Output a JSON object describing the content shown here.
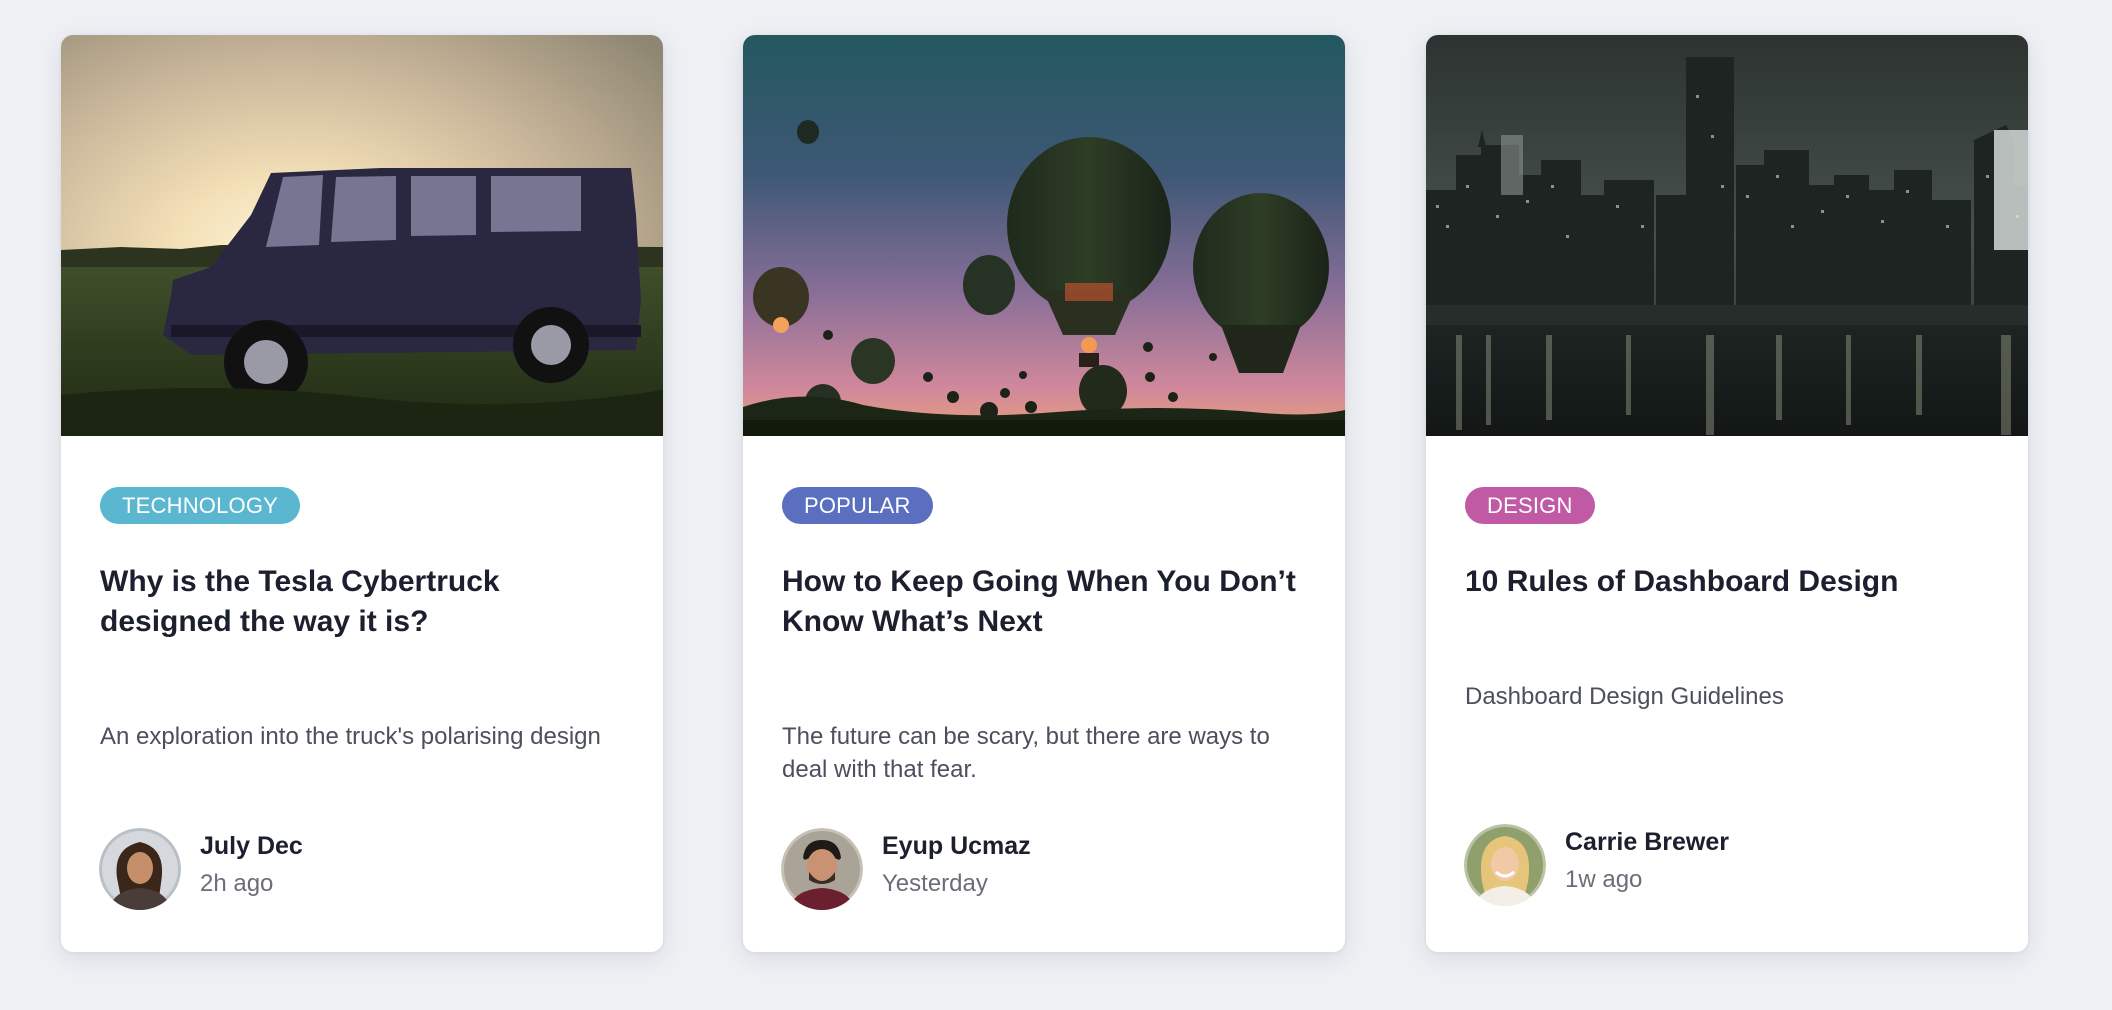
{
  "cards": [
    {
      "tag": "TECHNOLOGY",
      "tag_color": "#5bb7cf",
      "title": "Why is the Tesla Cybertruck designed the way it is?",
      "description": "An exploration into the truck's polarising design",
      "author": "July Dec",
      "time": "2h ago",
      "image": "vintage-truck-at-sunset-photo"
    },
    {
      "tag": "POPULAR",
      "tag_color": "#5a6fbf",
      "title": "How to Keep Going When You Don’t Know What’s Next",
      "description": "The future can be scary, but there are ways to deal with that fear.",
      "author": "Eyup Ucmaz",
      "time": "Yesterday",
      "image": "hot-air-balloons-at-dusk-photo"
    },
    {
      "tag": "DESIGN",
      "tag_color": "#c15aa5",
      "title": "10 Rules of Dashboard Design",
      "description": "Dashboard Design Guidelines",
      "author": "Carrie Brewer",
      "time": "1w ago",
      "image": "city-skyline-at-night-photo"
    }
  ]
}
